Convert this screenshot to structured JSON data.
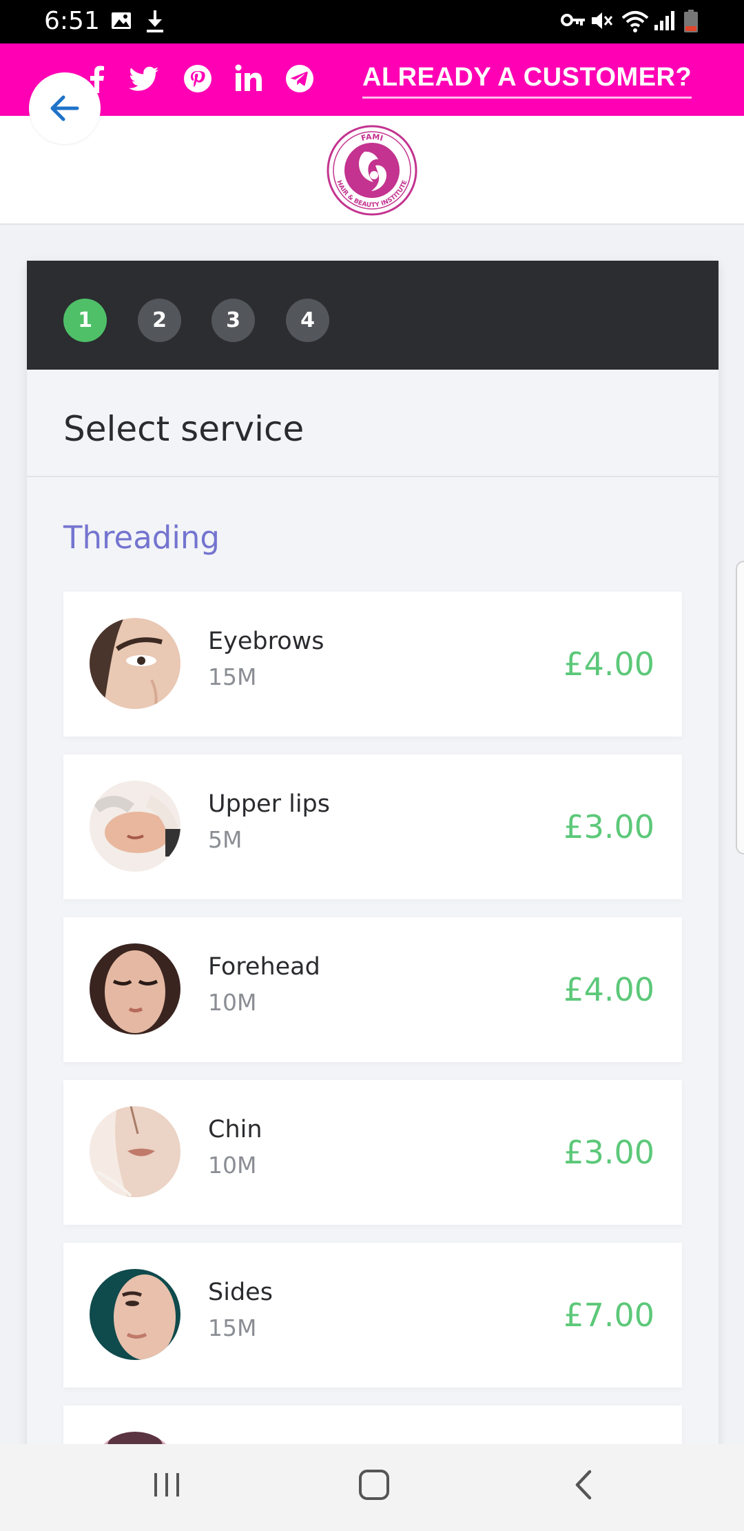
{
  "status_bar": {
    "time": "6:51"
  },
  "top_bar": {
    "social": [
      "facebook-icon",
      "twitter-icon",
      "pinterest-icon",
      "linkedin-icon",
      "telegram-icon"
    ],
    "cta_label": "ALREADY A CUSTOMER?"
  },
  "logo": {
    "top_text": "FAMI",
    "ring_text": "HAIR & BEAUTY INSTITUTE"
  },
  "wizard": {
    "steps": [
      "1",
      "2",
      "3",
      "4"
    ],
    "active_step": 1,
    "title": "Select service",
    "category": "Threading",
    "services": [
      {
        "name": "Eyebrows",
        "duration": "15M",
        "price": "£4.00"
      },
      {
        "name": "Upper lips",
        "duration": "5M",
        "price": "£3.00"
      },
      {
        "name": "Forehead",
        "duration": "10M",
        "price": "£4.00"
      },
      {
        "name": "Chin",
        "duration": "10M",
        "price": "£3.00"
      },
      {
        "name": "Sides",
        "duration": "15M",
        "price": "£7.00"
      }
    ]
  },
  "colors": {
    "brand_pink": "#ff00b4",
    "step_active": "#4fc068",
    "price_green": "#5cc879",
    "category_purple": "#7474d0"
  }
}
